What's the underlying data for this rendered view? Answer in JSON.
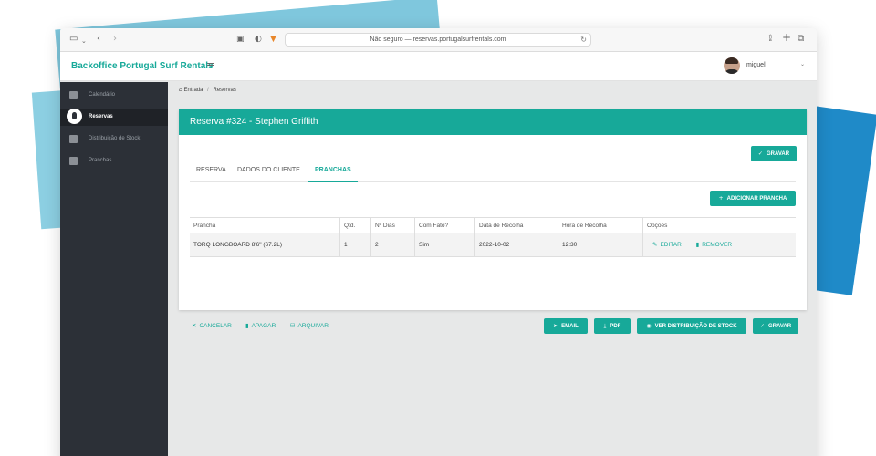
{
  "browser": {
    "url": "Não seguro — reservas.portugalsurfrentals.com"
  },
  "app": {
    "brand": "Backoffice Portugal Surf Rentals",
    "user": "miguel"
  },
  "sidebar": {
    "items": [
      {
        "label": "Calendário",
        "icon": "calendar-icon"
      },
      {
        "label": "Reservas",
        "icon": "user-icon",
        "active": true
      },
      {
        "label": "Distribuição de Stock",
        "icon": "box-icon"
      },
      {
        "label": "Pranchas",
        "icon": "board-icon"
      }
    ]
  },
  "breadcrumb": {
    "home": "Entrada",
    "current": "Reservas"
  },
  "card": {
    "title": "Reserva #324 - Stephen Griffith",
    "save_top": "GRAVAR",
    "tabs": [
      "RESERVA",
      "DADOS DO CLIENTE",
      "PRANCHAS"
    ],
    "active_tab": "PRANCHAS",
    "add_board": "ADICIONAR PRANCHA"
  },
  "table": {
    "headers": [
      "Prancha",
      "Qtd.",
      "Nº Dias",
      "Com Fato?",
      "Data de Recolha",
      "Hora de Recolha",
      "Opções"
    ],
    "rows": [
      {
        "prancha": "TORQ LONGBOARD 8'6\" (67.2L)",
        "qtd": "1",
        "dias": "2",
        "fato": "Sim",
        "data": "2022-10-02",
        "hora": "12:30",
        "edit": "EDITAR",
        "remove": "REMOVER"
      }
    ]
  },
  "footer": {
    "cancel": "CANCELAR",
    "delete": "APAGAR",
    "archive": "ARQUIVAR",
    "email": "EMAIL",
    "pdf": "PDF",
    "stock": "VER DISTRIBUIÇÃO DE STOCK",
    "save": "GRAVAR"
  },
  "colors": {
    "accent": "#17a999",
    "sidebar": "#2c3037"
  }
}
